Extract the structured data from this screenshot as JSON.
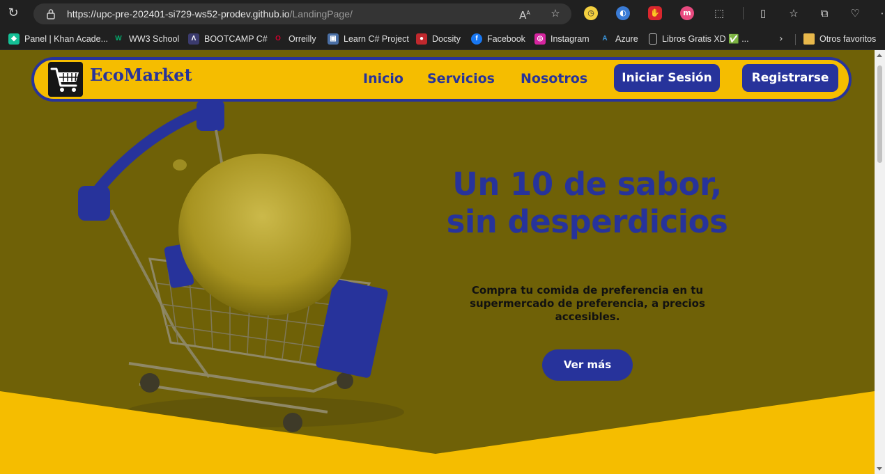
{
  "browser": {
    "url_main": "https://upc-pre-202401-si729-ws52-prodev.github.io",
    "url_path": "/LandingPage/",
    "bookmarks": [
      {
        "label": "Panel | Khan Acade...",
        "icon": "khan-academy-icon",
        "color": "#14bf96"
      },
      {
        "label": "WW3 School",
        "icon": "w3schools-icon",
        "color": "#04aa6d"
      },
      {
        "label": "BOOTCAMP C#",
        "icon": "bootcamp-icon",
        "color": "#3b3b6e"
      },
      {
        "label": "Orreilly",
        "icon": "oreilly-icon",
        "color": "#d3002d"
      },
      {
        "label": "Learn C# Project",
        "icon": "learn-csharp-icon",
        "color": "#4a6fa5"
      },
      {
        "label": "Docsity",
        "icon": "docsity-icon",
        "color": "#c0282d"
      },
      {
        "label": "Facebook",
        "icon": "facebook-icon",
        "color": "#1877f2"
      },
      {
        "label": "Instagram",
        "icon": "instagram-icon",
        "color": "#d6249f"
      },
      {
        "label": "Azure",
        "icon": "azure-icon",
        "color": "#0078d4"
      },
      {
        "label": "Libros Gratis XD ✅ ...",
        "icon": "document-icon",
        "color": "#5a5a5a"
      }
    ],
    "other_favorites": "Otros favoritos"
  },
  "site": {
    "brand": "EcoMarket",
    "nav": {
      "inicio": "Inicio",
      "servicios": "Servicios",
      "nosotros": "Nosotros",
      "login": "Iniciar Sesión",
      "register": "Registrarse"
    },
    "hero": {
      "headline_line1": "Un 10 de sabor,",
      "headline_line2": "sin desperdicios",
      "subtext": "Compra tu comida de preferencia en tu supermercado de preferencia, a precios accesibles.",
      "cta": "Ver más"
    }
  },
  "colors": {
    "accent_yellow": "#f5bd00",
    "brand_blue": "#27339b",
    "hero_overlay": "#6f6107"
  }
}
